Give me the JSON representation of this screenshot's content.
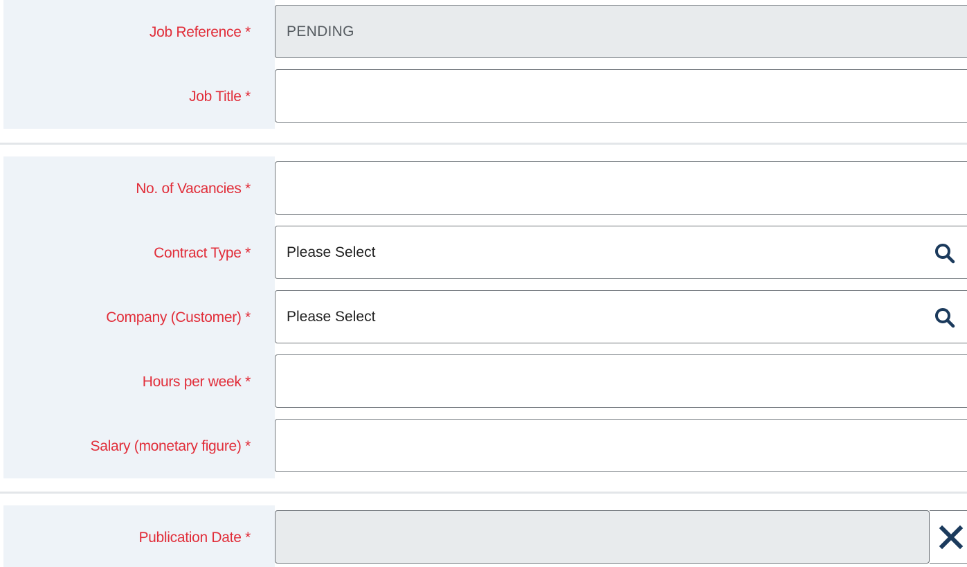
{
  "colors": {
    "label_required": "#e12d39",
    "label_background": "#eef3f8",
    "readonly_background": "#e8ebed",
    "icon_navy": "#1b3a5c"
  },
  "fields": {
    "job_reference": {
      "label": "Job Reference *",
      "value": "PENDING"
    },
    "job_title": {
      "label": "Job Title *",
      "value": ""
    },
    "vacancies": {
      "label": "No. of Vacancies *",
      "value": ""
    },
    "contract_type": {
      "label": "Contract Type *",
      "value": "Please Select",
      "icon": "search-icon"
    },
    "company": {
      "label": "Company (Customer) *",
      "value": "Please Select",
      "icon": "search-icon"
    },
    "hours": {
      "label": "Hours per week *",
      "value": ""
    },
    "salary": {
      "label": "Salary (monetary figure) *",
      "value": ""
    },
    "publication_date": {
      "label": "Publication Date *",
      "value": "",
      "clear_icon": "close-icon"
    }
  }
}
